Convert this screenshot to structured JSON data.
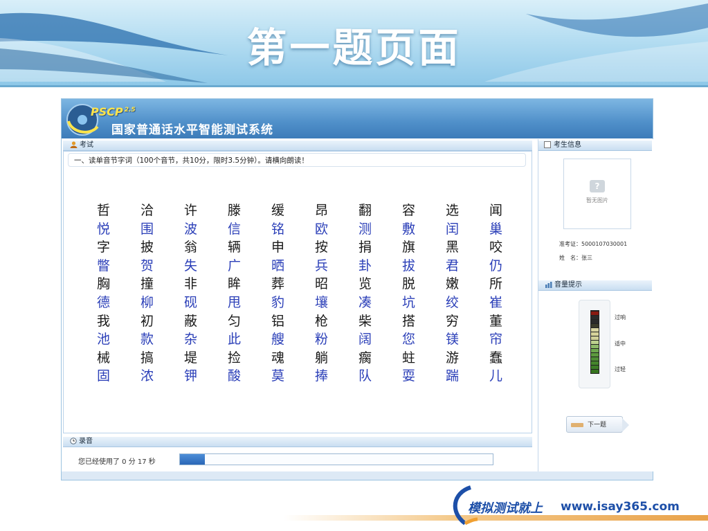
{
  "slide": {
    "title": "第一题页面",
    "brand_cn": "模拟测试就上",
    "brand_url": "www.isay365.com"
  },
  "app": {
    "logo_text": "PSCP",
    "logo_sup": "2.5",
    "system_title": "国家普通话水平智能测试系统",
    "exam_label": "考试",
    "instruction": "一、读单音节字词（100个音节，共10分，限时3.5分钟）。请横向朗读！",
    "recording_label": "录音",
    "recording_status": "您已经使用了 0  分 17 秒",
    "recording_progress": 0.08,
    "candidate_info_label": "考生信息",
    "photo_placeholder": "暂无图片",
    "photo_q": "?",
    "exam_id": "准考证：5000107030001",
    "name": "姓　名：张三",
    "volume_label": "音量提示",
    "volume_levels": [
      "过响",
      "适中",
      "过轻"
    ],
    "next_button": "下一题",
    "colors": {
      "black_row": "#1a1a1a",
      "blue_row": "#2b3fb8",
      "header": "#4f8fc9"
    }
  },
  "characters": [
    [
      "哲",
      "洽",
      "许",
      "滕",
      "缓",
      "昂",
      "翻",
      "容",
      "选",
      "闻"
    ],
    [
      "悦",
      "围",
      "波",
      "信",
      "铭",
      "欧",
      "测",
      "敷",
      "闰",
      "巢"
    ],
    [
      "字",
      "披",
      "翁",
      "辆",
      "申",
      "按",
      "捐",
      "旗",
      "黑",
      "咬"
    ],
    [
      "瞥",
      "贺",
      "失",
      "广",
      "晒",
      "兵",
      "卦",
      "拔",
      "君",
      "仍"
    ],
    [
      "胸",
      "撞",
      "非",
      "眸",
      "葬",
      "昭",
      "览",
      "脱",
      "嫩",
      "所"
    ],
    [
      "德",
      "柳",
      "砚",
      "甩",
      "豹",
      "壤",
      "凑",
      "坑",
      "绞",
      "崔"
    ],
    [
      "我",
      "初",
      "蔽",
      "匀",
      "铝",
      "枪",
      "柴",
      "搭",
      "穷",
      "董"
    ],
    [
      "池",
      "款",
      "杂",
      "此",
      "艘",
      "粉",
      "阔",
      "您",
      "镁",
      "帘"
    ],
    [
      "械",
      "搞",
      "堤",
      "捡",
      "魂",
      "躺",
      "瘸",
      "蛀",
      "游",
      "蠢"
    ],
    [
      "固",
      "浓",
      "钾",
      "酸",
      "莫",
      "捧",
      "队",
      "耍",
      "踹",
      "儿"
    ]
  ]
}
